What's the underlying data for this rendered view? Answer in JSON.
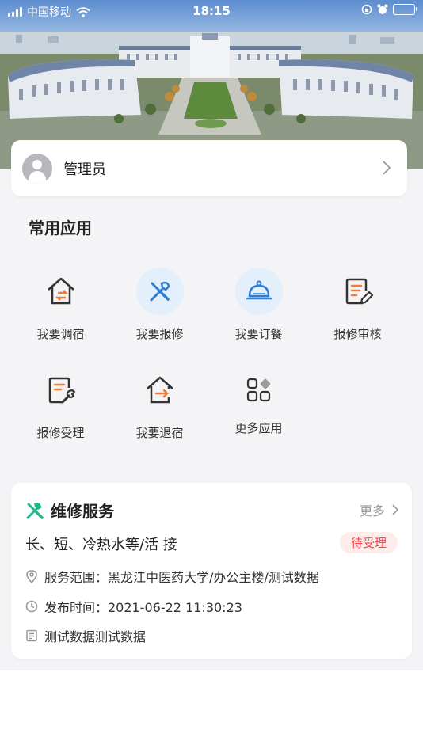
{
  "status_bar": {
    "carrier": "中国移动",
    "time": "18:15"
  },
  "user": {
    "name": "管理员"
  },
  "apps": {
    "title": "常用应用",
    "items": [
      {
        "label": "我要调宿",
        "icon": "house-swap-icon"
      },
      {
        "label": "我要报修",
        "icon": "tools-icon"
      },
      {
        "label": "我要订餐",
        "icon": "meal-cloche-icon"
      },
      {
        "label": "报修审核",
        "icon": "edit-document-icon"
      },
      {
        "label": "报修受理",
        "icon": "wrench-document-icon"
      },
      {
        "label": "我要退宿",
        "icon": "house-exit-icon"
      },
      {
        "label": "更多应用",
        "icon": "more-apps-icon"
      }
    ]
  },
  "repair": {
    "title": "维修服务",
    "more_label": "更多",
    "item_title": "长、短、冷热水等/活 接",
    "status": "待受理",
    "scope": "服务范围：黑龙江中医药大学/办公主楼/测试数据",
    "published": "发布时间：2021-06-22 11:30:23",
    "description": "测试数据测试数据"
  },
  "colors": {
    "accent_orange": "#f07a3a",
    "accent_blue": "#4aa3e8",
    "accent_green": "#19b98a",
    "badge_red": "#f0454a",
    "badge_bg": "#fdecea",
    "page_gray": "#f4f4f6"
  }
}
